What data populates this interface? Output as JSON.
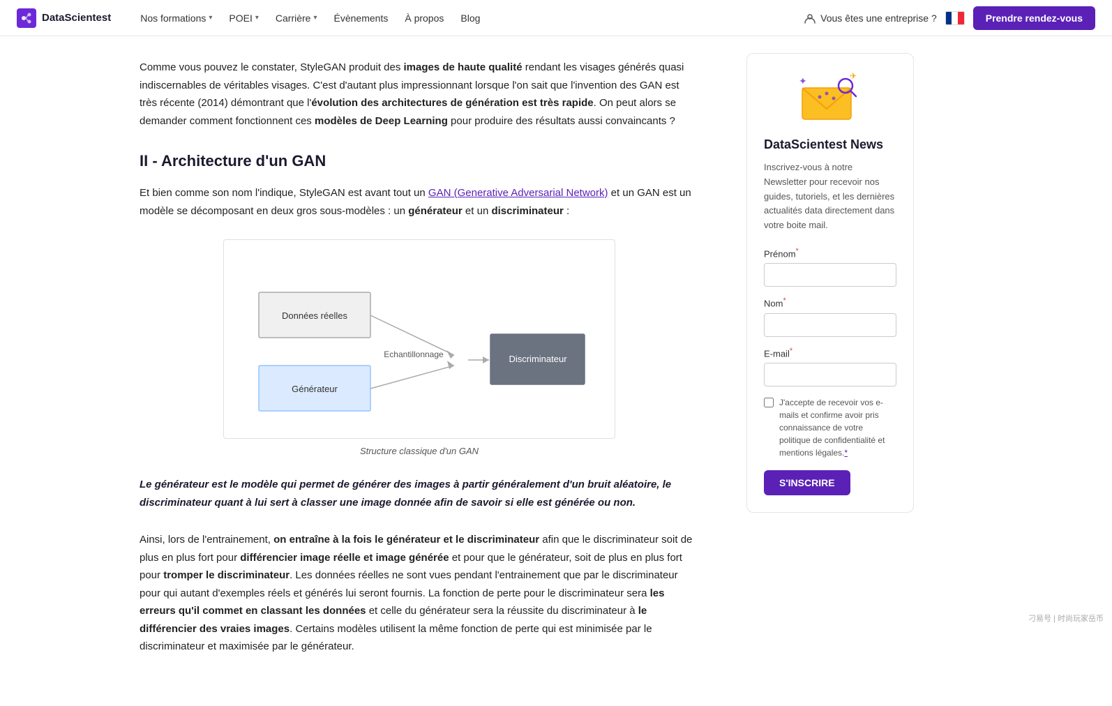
{
  "navbar": {
    "logo_text": "DataScientest",
    "formations_label": "Nos formations",
    "poei_label": "POEI",
    "carriere_label": "Carrière",
    "evenements_label": "Évènements",
    "apropos_label": "À propos",
    "blog_label": "Blog",
    "enterprise_label": "Vous êtes une entreprise ?",
    "cta_label": "Prendre rendez-vous"
  },
  "article": {
    "intro_text_1": "Comme vous pouvez le constater, StyleGAN produit des ",
    "intro_bold_1": "images de haute qualité",
    "intro_text_2": " rendant les visages générés quasi indiscernables de véritables visages. C'est d'autant plus impressionnant lorsque l'on sait que l'invention des GAN est très récente (2014) démontrant que l'",
    "intro_bold_2": "évolution des architectures de génération est très rapide",
    "intro_text_3": ". On peut alors se demander comment fonctionnent ces ",
    "intro_bold_3": "modèles de Deep Learning",
    "intro_text_4": " pour produire des résultats aussi convaincants ?",
    "section_heading": "II - Architecture d'un GAN",
    "section_intro_1": "Et bien comme son nom l'indique, StyleGAN est avant tout un ",
    "section_link": "GAN (Generative Adversarial Network)",
    "section_intro_2": " et un GAN est un modèle se décomposant en deux gros sous-modèles : un ",
    "section_bold_1": "générateur",
    "section_intro_3": " et un ",
    "section_bold_2": "discriminateur",
    "section_intro_4": " :",
    "diagram_caption": "Structure classique d'un GAN",
    "diagram_labels": {
      "donnees_reelles": "Données réelles",
      "echantillonnage": "Echantillonnage",
      "discriminateur": "Discriminateur",
      "generateur": "Générateur"
    },
    "blockquote": "Le générateur est le modèle qui permet de générer des images à partir généralement d'un bruit aléatoire, le discriminateur quant à lui sert à classer une image donnée afin de savoir si elle est générée ou non.",
    "para2_text_1": "Ainsi, lors de l'entrainement, ",
    "para2_bold_1": "on entraîne à la fois le générateur et le discriminateur",
    "para2_text_2": " afin que le discriminateur soit de plus en plus fort pour ",
    "para2_bold_2": "différencier image réelle et image générée",
    "para2_text_3": " et pour que le générateur, soit de plus en plus fort pour ",
    "para2_bold_3": "tromper le discriminateur",
    "para2_text_4": ". Les données réelles ne sont vues pendant l'entrainement que par le discriminateur pour qui autant d'exemples réels et générés lui seront fournis. La fonction de perte pour le discriminateur sera ",
    "para2_bold_4": "les erreurs qu'il commet en classant les données",
    "para2_text_5": " et celle du générateur sera la réussite du discriminateur à ",
    "para2_bold_5": "le différencier des vraies images",
    "para2_text_6": ". Certains modèles utilisent la même fonction de perte qui est minimisée par le discriminateur et maximisée par le générateur."
  },
  "sidebar": {
    "title": "DataScientest News",
    "description": "Inscrivez-vous à notre Newsletter pour recevoir nos guides, tutoriels, et les dernières actualités data directement dans votre boite mail.",
    "prenom_label": "Prénom",
    "nom_label": "Nom",
    "email_label": "E-mail",
    "required_mark": "*",
    "checkbox_text": "J'accepte de recevoir vos e-mails et confirme avoir pris connaissance de votre politique de confidentialité et mentions légales.",
    "subscribe_label": "S'INSCRIRE"
  },
  "watermark": "刁易号 | 时尚玩家岳币"
}
